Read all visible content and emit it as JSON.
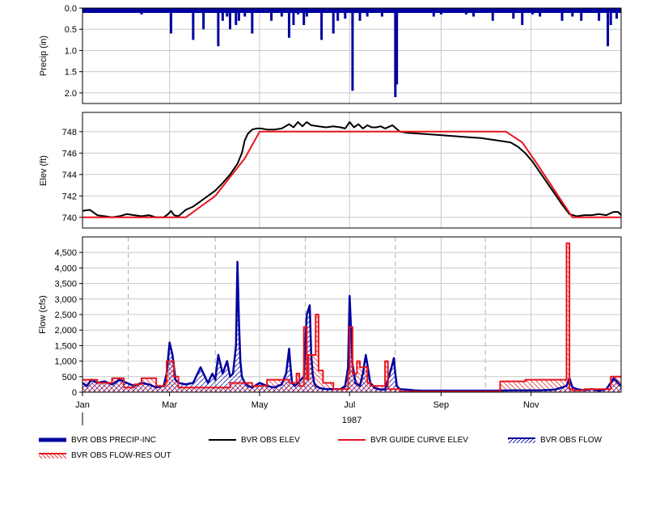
{
  "chart_data": [
    {
      "type": "bar",
      "ylabel": "Precip (in)",
      "xlim": [
        0,
        365
      ],
      "ylim": [
        0,
        2.25
      ],
      "y_inverted": true,
      "yticks": [
        0.0,
        0.5,
        1.0,
        1.5,
        2.0
      ],
      "ytick_labels": [
        "0.0",
        "0.5",
        "1.0",
        "1.5",
        "2.0"
      ],
      "grid": true,
      "series": [
        {
          "name": "BVR OBS PRECIP-INC",
          "color": "#0000a0",
          "x": [
            2,
            14,
            28,
            40,
            55,
            60,
            65,
            75,
            82,
            88,
            92,
            95,
            98,
            100,
            104,
            106,
            110,
            115,
            120,
            128,
            135,
            140,
            143,
            146,
            150,
            152,
            158,
            162,
            170,
            173,
            178,
            183,
            188,
            193,
            197,
            203,
            208,
            213,
            214,
            220,
            226,
            230,
            238,
            243,
            250,
            260,
            265,
            272,
            278,
            285,
            292,
            298,
            305,
            310,
            315,
            325,
            332,
            338,
            343,
            350,
            356,
            358,
            362
          ],
          "values": [
            0.1,
            0.1,
            0.05,
            0.15,
            0.1,
            0.6,
            0.1,
            0.75,
            0.5,
            0.1,
            0.9,
            0.3,
            0.2,
            0.5,
            0.4,
            0.3,
            0.2,
            0.6,
            0.1,
            0.3,
            0.2,
            0.7,
            0.4,
            0.15,
            0.4,
            0.2,
            0.1,
            0.75,
            0.6,
            0.3,
            0.25,
            0.4,
            0.3,
            0.2,
            0.1,
            0.2,
            0.1,
            0.2,
            0.05,
            0.1,
            0.1,
            0.1,
            0.2,
            0.15,
            0.1,
            0.15,
            0.2,
            0.1,
            0.3,
            0.1,
            0.25,
            0.4,
            0.15,
            0.2,
            0.1,
            0.3,
            0.2,
            0.3,
            0.1,
            0.3,
            0.9,
            0.4,
            0.25
          ],
          "large_events": [
            {
              "x": 183,
              "value": 1.95
            },
            {
              "x": 212,
              "value": 2.1
            },
            {
              "x": 213,
              "value": 1.8
            }
          ]
        }
      ]
    },
    {
      "type": "line",
      "ylabel": "Elev (ft)",
      "xlim": [
        0,
        365
      ],
      "ylim": [
        739,
        749.8
      ],
      "yticks": [
        740,
        742,
        744,
        746,
        748
      ],
      "ytick_labels": [
        "740",
        "742",
        "744",
        "746",
        "748"
      ],
      "grid": true,
      "series": [
        {
          "name": "BVR OBS ELEV",
          "color": "#000000",
          "x": [
            0,
            5,
            10,
            15,
            20,
            25,
            30,
            35,
            40,
            45,
            50,
            55,
            58,
            60,
            62,
            65,
            70,
            75,
            80,
            85,
            90,
            95,
            100,
            105,
            108,
            110,
            112,
            115,
            118,
            121,
            125,
            130,
            135,
            140,
            143,
            146,
            149,
            152,
            155,
            160,
            165,
            170,
            175,
            178,
            181,
            184,
            187,
            190,
            193,
            196,
            199,
            202,
            205,
            210,
            215,
            220,
            230,
            240,
            250,
            260,
            270,
            280,
            290,
            295,
            300,
            305,
            310,
            315,
            320,
            325,
            330,
            335,
            340,
            345,
            350,
            355,
            358,
            360,
            363,
            365
          ],
          "values": [
            740.6,
            740.7,
            740.2,
            740.1,
            740.0,
            740.1,
            740.3,
            740.2,
            740.1,
            740.2,
            740.0,
            740.0,
            740.3,
            740.6,
            740.2,
            740.1,
            740.7,
            741.0,
            741.5,
            742.0,
            742.5,
            743.2,
            744.0,
            745.0,
            746.0,
            747.2,
            747.8,
            748.2,
            748.3,
            748.3,
            748.2,
            748.2,
            748.3,
            748.7,
            748.4,
            748.9,
            748.5,
            748.9,
            748.6,
            748.5,
            748.4,
            748.5,
            748.4,
            748.3,
            748.9,
            748.4,
            748.7,
            748.3,
            748.6,
            748.4,
            748.4,
            748.5,
            748.3,
            748.6,
            748.0,
            747.9,
            747.8,
            747.7,
            747.6,
            747.5,
            747.4,
            747.2,
            747.0,
            746.6,
            746.0,
            745.2,
            744.2,
            743.2,
            742.2,
            741.2,
            740.3,
            740.1,
            740.2,
            740.2,
            740.3,
            740.2,
            740.4,
            740.5,
            740.5,
            740.2
          ]
        },
        {
          "name": "BVR GUIDE CURVE ELEV",
          "color": "#e8141c",
          "x": [
            0,
            70,
            90,
            110,
            120,
            287,
            298,
            308,
            320,
            332,
            365
          ],
          "values": [
            740.0,
            740.0,
            742.0,
            745.5,
            748.0,
            748.0,
            747.0,
            745.0,
            742.5,
            740.0,
            740.0
          ]
        }
      ]
    },
    {
      "type": "line",
      "xlabel": "1987",
      "ylabel": "Flow (cfs)",
      "xlim": [
        0,
        365
      ],
      "ylim": [
        0,
        5000
      ],
      "yticks": [
        0,
        500,
        1000,
        1500,
        2000,
        2500,
        3000,
        3500,
        4000,
        4500
      ],
      "ytick_labels": [
        "0",
        "500",
        "1,000",
        "1,500",
        "2,000",
        "2,500",
        "3,000",
        "3,500",
        "4,000",
        "4,500"
      ],
      "xticks": [
        0,
        59,
        120,
        181,
        243,
        304
      ],
      "xtick_labels": [
        "Jan",
        "Mar",
        "May",
        "Jul",
        "Sep",
        "Nov"
      ],
      "dashed_gridlines_x": [
        31,
        90,
        151,
        212,
        273
      ],
      "grid": true,
      "series": [
        {
          "name": "BVR OBS FLOW",
          "color": "#0000a0",
          "fill": "hatched",
          "x": [
            0,
            3,
            6,
            10,
            15,
            20,
            25,
            30,
            35,
            40,
            45,
            50,
            55,
            57,
            59,
            61,
            63,
            65,
            70,
            75,
            80,
            85,
            88,
            90,
            92,
            95,
            98,
            100,
            102,
            104,
            105,
            106,
            107,
            108,
            110,
            112,
            115,
            120,
            125,
            130,
            135,
            138,
            140,
            141,
            142,
            144,
            146,
            150,
            152,
            154,
            155,
            156,
            157,
            158,
            160,
            162,
            165,
            170,
            175,
            178,
            180,
            181,
            182,
            183,
            185,
            188,
            190,
            192,
            193,
            195,
            198,
            200,
            205,
            210,
            211,
            212,
            213,
            215,
            220,
            225,
            230,
            240,
            250,
            260,
            270,
            280,
            290,
            300,
            310,
            320,
            328,
            330,
            332,
            335,
            340,
            345,
            350,
            355,
            360,
            365
          ],
          "values": [
            300,
            200,
            400,
            300,
            350,
            250,
            400,
            300,
            200,
            300,
            250,
            150,
            200,
            600,
            1600,
            1200,
            400,
            300,
            250,
            300,
            800,
            300,
            600,
            400,
            1200,
            600,
            1000,
            500,
            600,
            1500,
            4200,
            2300,
            1000,
            500,
            300,
            200,
            150,
            300,
            200,
            150,
            250,
            600,
            1400,
            800,
            300,
            200,
            300,
            500,
            2500,
            2800,
            1200,
            600,
            300,
            200,
            150,
            120,
            100,
            100,
            100,
            200,
            800,
            3100,
            2000,
            900,
            300,
            200,
            600,
            1200,
            900,
            300,
            150,
            100,
            80,
            900,
            1100,
            600,
            200,
            100,
            80,
            60,
            50,
            50,
            50,
            50,
            50,
            50,
            60,
            60,
            60,
            80,
            200,
            450,
            150,
            100,
            60,
            100,
            50,
            100,
            450,
            200
          ]
        },
        {
          "name": "BVR OBS FLOW-RES OUT",
          "color": "#e8141c",
          "fill": "hatched",
          "x": [
            0,
            10,
            10,
            20,
            20,
            28,
            28,
            35,
            35,
            40,
            40,
            50,
            50,
            56,
            56,
            57,
            57,
            62,
            62,
            65,
            65,
            100,
            100,
            115,
            115,
            125,
            125,
            140,
            140,
            145,
            145,
            147,
            147,
            150,
            150,
            152,
            152,
            153,
            153,
            158,
            158,
            160,
            160,
            163,
            163,
            170,
            170,
            180,
            180,
            181,
            181,
            183,
            183,
            186,
            186,
            188,
            188,
            193,
            193,
            195,
            195,
            205,
            205,
            207,
            207,
            215,
            215,
            283,
            283,
            300,
            300,
            328,
            328,
            330,
            330,
            332,
            332,
            340,
            340,
            358,
            358,
            365
          ],
          "values": [
            400,
            400,
            300,
            300,
            450,
            450,
            150,
            150,
            250,
            250,
            450,
            450,
            200,
            200,
            300,
            300,
            1000,
            1000,
            500,
            500,
            150,
            150,
            300,
            300,
            200,
            200,
            400,
            400,
            300,
            300,
            600,
            600,
            200,
            200,
            2100,
            2100,
            400,
            400,
            1200,
            1200,
            2500,
            2500,
            700,
            700,
            300,
            300,
            100,
            100,
            600,
            600,
            2100,
            2100,
            600,
            600,
            1000,
            1000,
            800,
            800,
            300,
            300,
            200,
            200,
            1000,
            1000,
            100,
            100,
            20,
            20,
            350,
            350,
            400,
            400,
            4800,
            4800,
            100,
            100,
            60,
            60,
            100,
            100,
            500,
            500
          ]
        }
      ]
    }
  ],
  "legend": {
    "precip": "BVR OBS PRECIP-INC",
    "elev": "BVR OBS ELEV",
    "guide": "BVR GUIDE CURVE ELEV",
    "flow": "BVR OBS FLOW",
    "resout": "BVR OBS FLOW-RES OUT"
  },
  "colors": {
    "blue": "#0000a0",
    "black": "#000000",
    "red": "#e8141c",
    "grid": "#c8c8c8"
  }
}
